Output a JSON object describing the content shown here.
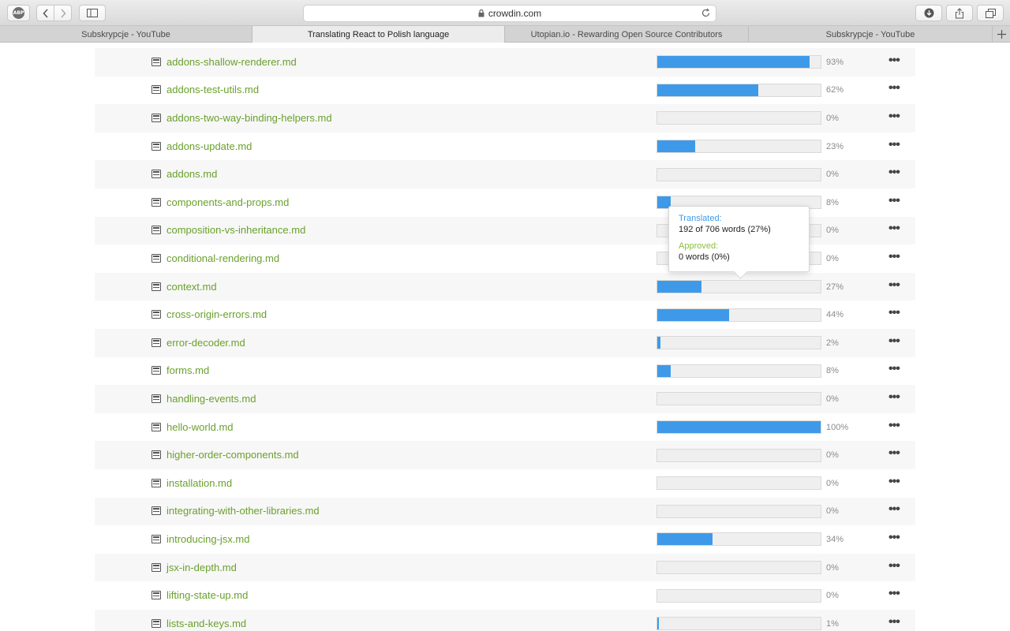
{
  "browser": {
    "adblock_label": "ABP",
    "url": "crowdin.com"
  },
  "tabs": [
    {
      "label": "Subskrypcje - YouTube",
      "active": false
    },
    {
      "label": "Translating React to Polish language",
      "active": true
    },
    {
      "label": "Utopian.io - Rewarding Open Source Contributors",
      "active": false
    },
    {
      "label": "Subskrypcje - YouTube",
      "active": false
    }
  ],
  "colors": {
    "accent": "#3e9ae8",
    "file_link": "#6aa02d",
    "approved": "#8bbf3c"
  },
  "files": [
    {
      "name": "addons-shallow-renderer.md",
      "progress": 93,
      "percent_label": "93%"
    },
    {
      "name": "addons-test-utils.md",
      "progress": 62,
      "percent_label": "62%"
    },
    {
      "name": "addons-two-way-binding-helpers.md",
      "progress": 0,
      "percent_label": "0%"
    },
    {
      "name": "addons-update.md",
      "progress": 23,
      "percent_label": "23%"
    },
    {
      "name": "addons.md",
      "progress": 0,
      "percent_label": "0%"
    },
    {
      "name": "components-and-props.md",
      "progress": 8,
      "percent_label": "8%"
    },
    {
      "name": "composition-vs-inheritance.md",
      "progress": 0,
      "percent_label": "0%"
    },
    {
      "name": "conditional-rendering.md",
      "progress": 0,
      "percent_label": "0%"
    },
    {
      "name": "context.md",
      "progress": 27,
      "percent_label": "27%"
    },
    {
      "name": "cross-origin-errors.md",
      "progress": 44,
      "percent_label": "44%"
    },
    {
      "name": "error-decoder.md",
      "progress": 2,
      "percent_label": "2%"
    },
    {
      "name": "forms.md",
      "progress": 8,
      "percent_label": "8%"
    },
    {
      "name": "handling-events.md",
      "progress": 0,
      "percent_label": "0%"
    },
    {
      "name": "hello-world.md",
      "progress": 100,
      "percent_label": "100%"
    },
    {
      "name": "higher-order-components.md",
      "progress": 0,
      "percent_label": "0%"
    },
    {
      "name": "installation.md",
      "progress": 0,
      "percent_label": "0%"
    },
    {
      "name": "integrating-with-other-libraries.md",
      "progress": 0,
      "percent_label": "0%"
    },
    {
      "name": "introducing-jsx.md",
      "progress": 34,
      "percent_label": "34%"
    },
    {
      "name": "jsx-in-depth.md",
      "progress": 0,
      "percent_label": "0%"
    },
    {
      "name": "lifting-state-up.md",
      "progress": 0,
      "percent_label": "0%"
    },
    {
      "name": "lists-and-keys.md",
      "progress": 1,
      "percent_label": "1%"
    }
  ],
  "more_label": "•••",
  "tooltip": {
    "translated_label": "Translated:",
    "translated_value": "192 of 706 words (27%)",
    "approved_label": "Approved:",
    "approved_value": "0 words (0%)"
  }
}
